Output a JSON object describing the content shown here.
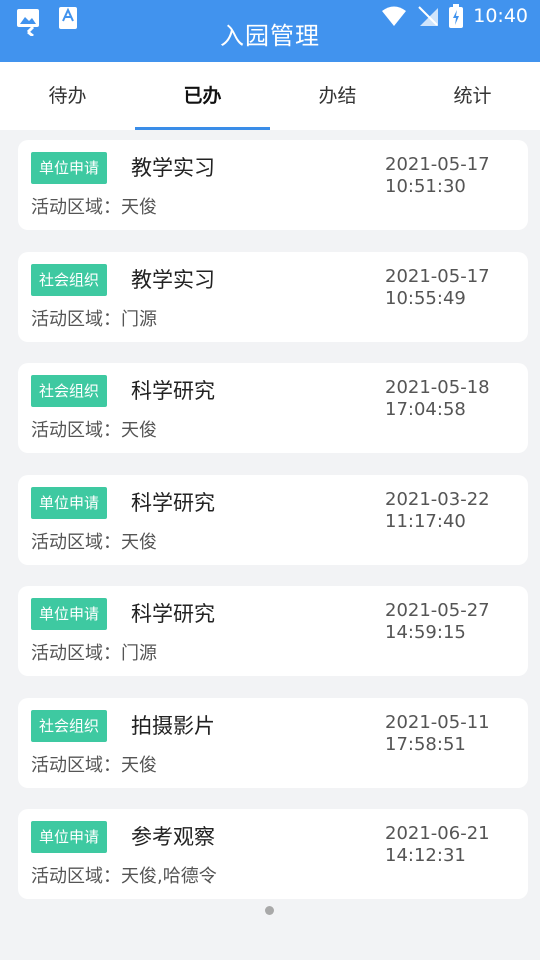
{
  "status_bar": {
    "time": "10:40"
  },
  "header": {
    "title": "入园管理"
  },
  "tabs": [
    {
      "label": "待办",
      "active": false
    },
    {
      "label": "已办",
      "active": true
    },
    {
      "label": "办结",
      "active": false
    },
    {
      "label": "统计",
      "active": false
    }
  ],
  "area_label": "活动区域：",
  "items": [
    {
      "badge": "单位申请",
      "title": "教学实习",
      "area": "天俊",
      "date": "2021-05-17",
      "time": "10:51:30"
    },
    {
      "badge": "社会组织",
      "title": "教学实习",
      "area": "门源",
      "date": "2021-05-17",
      "time": "10:55:49"
    },
    {
      "badge": "社会组织",
      "title": "科学研究",
      "area": "天俊",
      "date": "2021-05-18",
      "time": "17:04:58"
    },
    {
      "badge": "单位申请",
      "title": "科学研究",
      "area": "天俊",
      "date": "2021-03-22",
      "time": "11:17:40"
    },
    {
      "badge": "单位申请",
      "title": "科学研究",
      "area": "门源",
      "date": "2021-05-27",
      "time": "14:59:15"
    },
    {
      "badge": "社会组织",
      "title": "拍摄影片",
      "area": "天俊",
      "date": "2021-05-11",
      "time": "17:58:51"
    },
    {
      "badge": "单位申请",
      "title": "参考观察",
      "area": "天俊,哈德令",
      "date": "2021-06-21",
      "time": "14:12:31"
    }
  ],
  "colors": {
    "header": "#4193ee",
    "badge": "#3ec9a1",
    "tab_indicator": "#3a8de8"
  }
}
